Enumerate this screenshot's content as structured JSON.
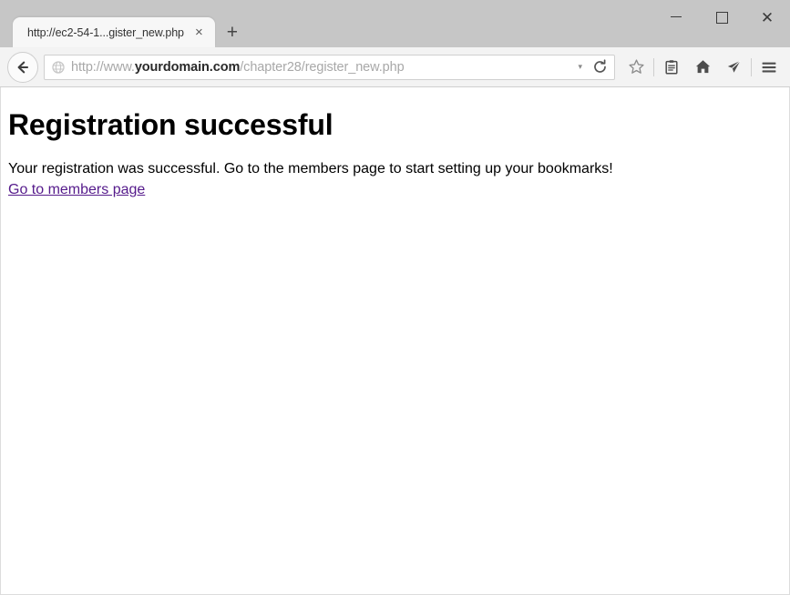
{
  "window": {
    "controls": {
      "minimize": "minimize",
      "maximize": "maximize",
      "close": "close"
    }
  },
  "tabs": {
    "items": [
      {
        "title": "http://ec2-54-1...gister_new.php",
        "close_label": "×"
      }
    ],
    "new_tab_label": "+"
  },
  "toolbar": {
    "back_label": "Back",
    "url": {
      "prefix": "http://www.",
      "domain": "yourdomain.com",
      "path": "/chapter28/register_new.php",
      "full": "http://www.yourdomain.com/chapter28/register_new.php",
      "dropdown_glyph": "▾"
    },
    "reload_label": "Reload",
    "icons": [
      {
        "name": "bookmark-star-icon",
        "label": "Bookmark this page"
      },
      {
        "name": "reader-view-icon",
        "label": "Reader view"
      },
      {
        "name": "home-icon",
        "label": "Home"
      },
      {
        "name": "pocket-icon",
        "label": "Save to Pocket"
      },
      {
        "name": "menu-icon",
        "label": "Open menu"
      }
    ]
  },
  "page": {
    "heading": "Registration successful",
    "paragraph": "Your registration was successful. Go to the members page to start setting up your bookmarks!",
    "link_text": "Go to members page",
    "link_color": "#551a8b"
  }
}
